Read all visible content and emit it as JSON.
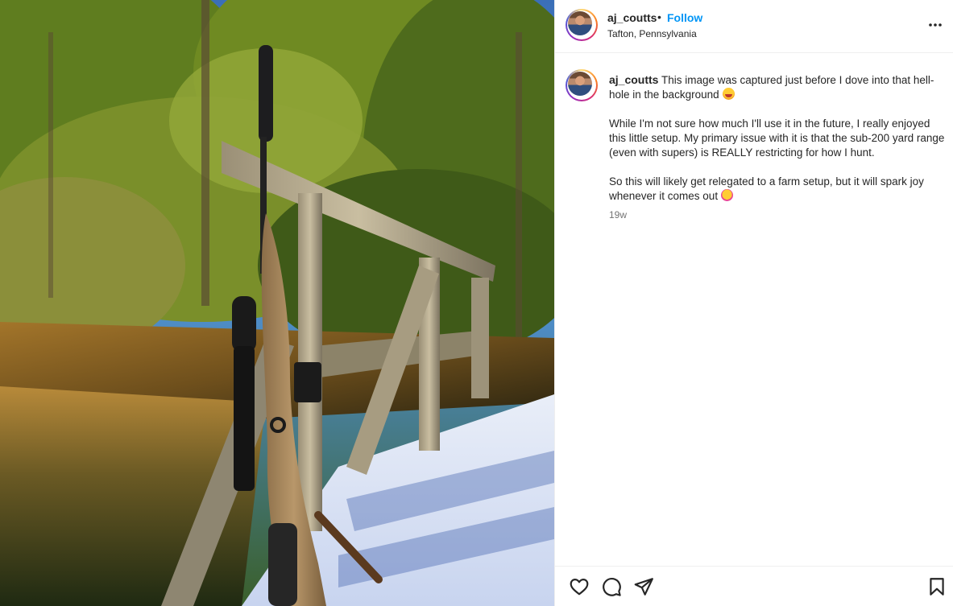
{
  "post": {
    "media": {
      "alt": "Rifle with scope leaning on a wooden bridge railing in a snowy forest"
    },
    "header": {
      "username": "aj_coutts",
      "separator": "•",
      "follow_label": "Follow",
      "location": "Tafton, Pennsylvania",
      "more_icon": "more-horizontal-icon"
    },
    "caption": {
      "username": "aj_coutts",
      "paragraph1": "This image was captured just before I dove into that hell-hole in the background",
      "paragraph2": "While I'm not sure how much I'll use it in the future, I really enjoyed this little setup. My primary issue with it is that the sub-200 yard range (even with supers) is REALLY restricting for how I hunt.",
      "paragraph3": "So this will likely get relegated to a farm setup, but it will spark joy whenever it comes out",
      "timestamp": "19w"
    },
    "actions": {
      "like_icon": "heart-icon",
      "comment_icon": "comment-icon",
      "share_icon": "send-icon",
      "save_icon": "bookmark-icon"
    }
  },
  "colors": {
    "link_blue": "#0095f6",
    "text": "#262626",
    "muted": "#737373",
    "border": "#efefef"
  }
}
